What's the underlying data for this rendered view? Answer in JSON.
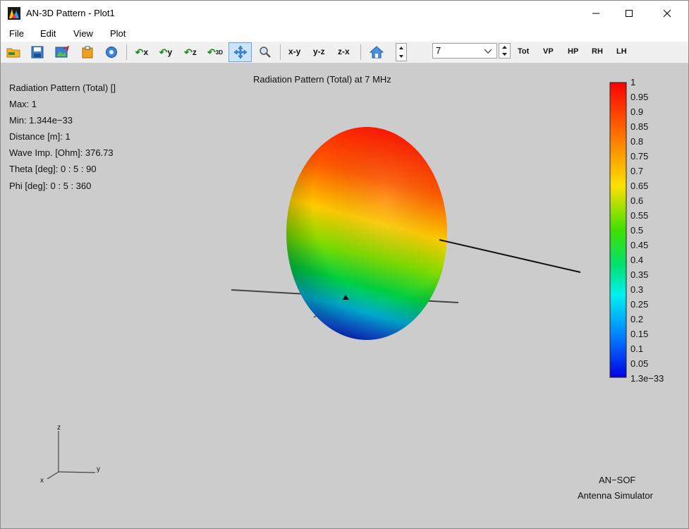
{
  "window": {
    "title": "AN-3D Pattern - Plot1"
  },
  "menu": {
    "items": [
      "File",
      "Edit",
      "View",
      "Plot"
    ]
  },
  "toolbar": {
    "view_xy": "x-y",
    "view_yz": "y-z",
    "view_zx": "z-x",
    "rot_x": "x",
    "rot_y": "y",
    "rot_z": "z",
    "rot_3d": "3D",
    "frequency_value": "7",
    "pol_tot": "Tot",
    "pol_vp": "VP",
    "pol_hp": "HP",
    "pol_rh": "RH",
    "pol_lh": "LH"
  },
  "plot": {
    "title": "Radiation Pattern (Total) at 7 MHz",
    "info": {
      "quantity": "Radiation Pattern (Total) []",
      "max": "Max: 1",
      "min": "Min: 1.344e−33",
      "distance": "Distance [m]: 1",
      "wave_imp": "Wave Imp. [Ohm]: 376.73",
      "theta": "Theta [deg]: 0 : 5 : 90",
      "phi": "Phi [deg]: 0 : 5 : 360"
    },
    "colorbar": {
      "labels": [
        "1",
        "0.95",
        "0.9",
        "0.85",
        "0.8",
        "0.75",
        "0.7",
        "0.65",
        "0.6",
        "0.55",
        "0.5",
        "0.45",
        "0.4",
        "0.35",
        "0.3",
        "0.25",
        "0.2",
        "0.15",
        "0.1",
        "0.05",
        "1.3e−33"
      ]
    },
    "triad": {
      "x": "x",
      "y": "y",
      "z": "z"
    },
    "watermark": {
      "line1": "AN−SOF",
      "line2": "Antenna Simulator"
    }
  }
}
